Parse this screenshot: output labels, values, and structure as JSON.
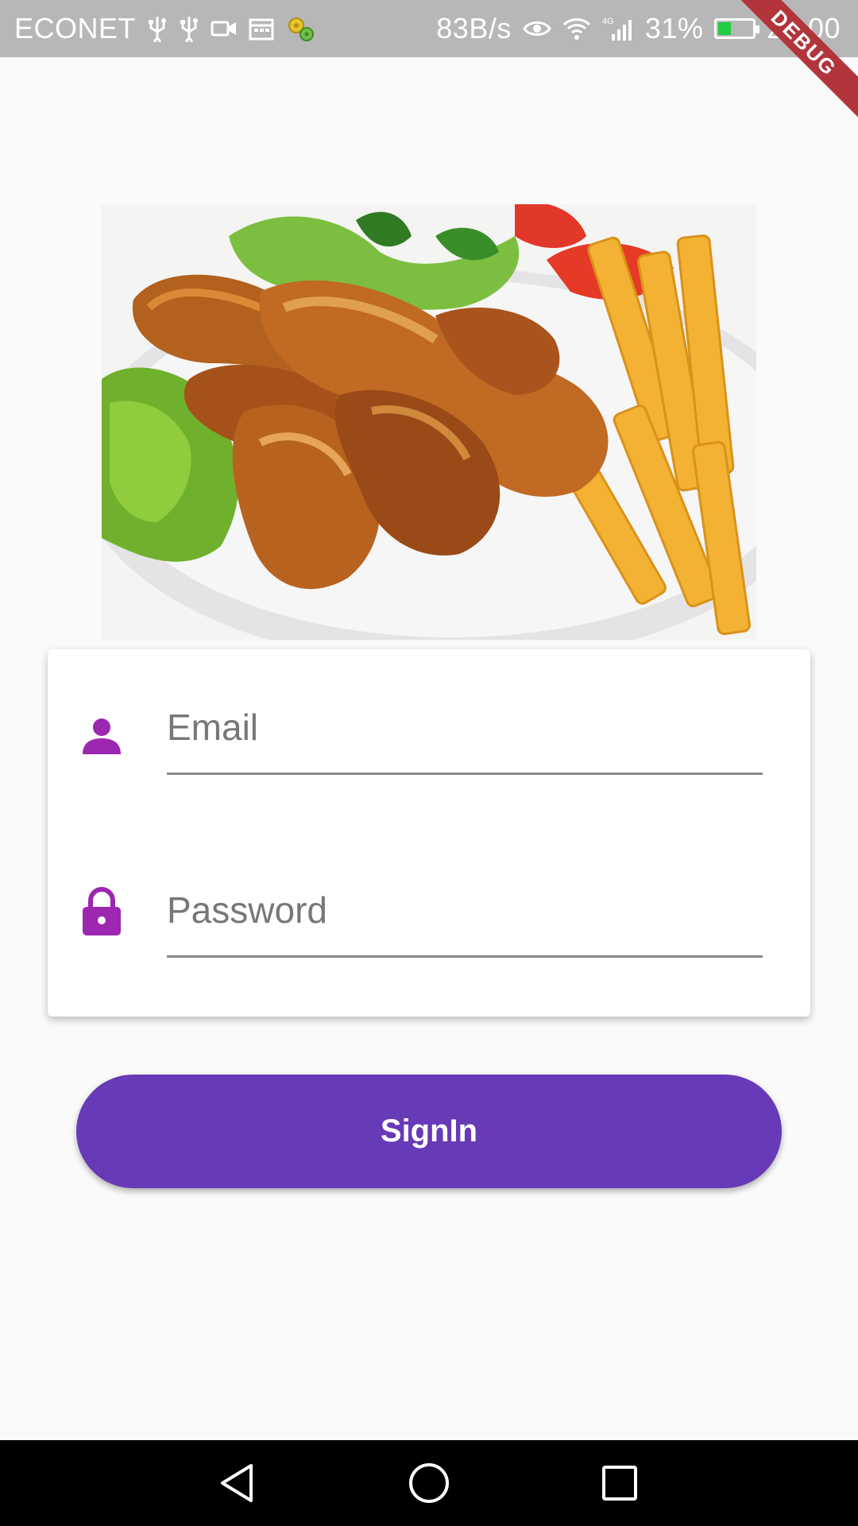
{
  "status_bar": {
    "carrier": "ECONET",
    "network_speed": "83B/s",
    "network_type": "4G",
    "battery_percent": "31%",
    "time": "22:00"
  },
  "debug_banner": "DEBUG",
  "login_form": {
    "email_placeholder": "Email",
    "password_placeholder": "Password"
  },
  "signin_button_label": "SignIn",
  "colors": {
    "accent_icon": "#9c27b0",
    "button": "#673ab7",
    "status_bar": "#b7b7b7",
    "debug_ribbon": "#b2353c"
  },
  "icons": {
    "email_field": "person-icon",
    "password_field": "lock-icon"
  }
}
